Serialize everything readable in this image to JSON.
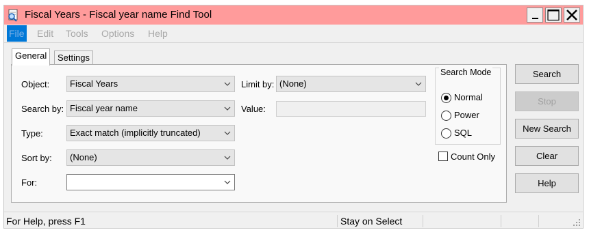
{
  "window": {
    "title": "Fiscal Years - Fiscal year name Find Tool",
    "title_bg": "#ff9b9b"
  },
  "menu": [
    "File",
    "Edit",
    "Tools",
    "Options",
    "Help"
  ],
  "tabs": [
    "General",
    "Settings"
  ],
  "form": {
    "object_label": "Object:",
    "object_value": "Fiscal Years",
    "search_by_label": "Search by:",
    "search_by_value": "Fiscal year name",
    "type_label": "Type:",
    "type_value": "Exact match (implicitly truncated)",
    "sort_by_label": "Sort by:",
    "sort_by_value": "(None)",
    "for_label": "For:",
    "for_value": "",
    "limit_by_label": "Limit by:",
    "limit_by_value": "(None)",
    "value_label": "Value:",
    "value_value": ""
  },
  "search_mode": {
    "title": "Search Mode",
    "options": [
      "Normal",
      "Power",
      "SQL"
    ],
    "selected": "Normal"
  },
  "count_only": {
    "label": "Count Only",
    "checked": false
  },
  "buttons": {
    "search": "Search",
    "stop": "Stop",
    "new_search": "New Search",
    "clear": "Clear",
    "help": "Help"
  },
  "status": {
    "help_text": "For Help, press F1",
    "mode_text": "Stay on Select"
  },
  "icons": {
    "app": "find-tool-icon",
    "dropdown": "chevron-down-icon",
    "minimize": "minimize-icon",
    "maximize": "maximize-icon",
    "close": "close-icon",
    "grip": "resize-grip-icon"
  },
  "accent": "#0078d7"
}
